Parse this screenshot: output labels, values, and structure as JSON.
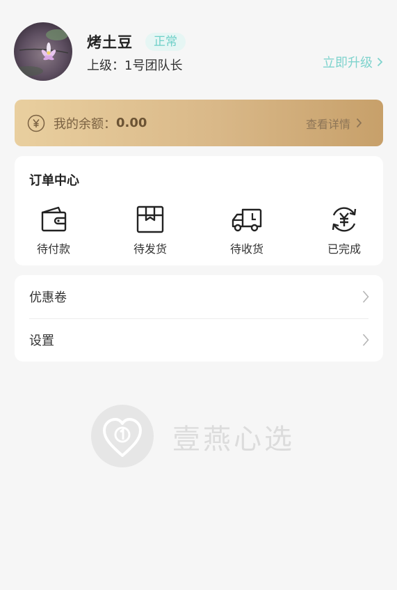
{
  "profile": {
    "username": "烤土豆",
    "status": "正常",
    "superior": "上级：1号团队长",
    "upgrade_label": "立即升级"
  },
  "balance": {
    "label": "我的余额：",
    "value": "0.00",
    "detail_label": "查看详情"
  },
  "orders": {
    "title": "订单中心",
    "items": [
      {
        "label": "待付款",
        "icon": "wallet-icon"
      },
      {
        "label": "待发货",
        "icon": "box-icon"
      },
      {
        "label": "待收货",
        "icon": "truck-icon"
      },
      {
        "label": "已完成",
        "icon": "yen-refresh-icon"
      }
    ]
  },
  "menu": {
    "items": [
      {
        "label": "优惠卷"
      },
      {
        "label": "设置"
      }
    ]
  },
  "brand": {
    "name": "壹燕心选"
  },
  "colors": {
    "accent": "#7fd3cd",
    "gold_start": "#e9cf9f",
    "gold_end": "#c7a06a",
    "background": "#f6f6f6"
  }
}
